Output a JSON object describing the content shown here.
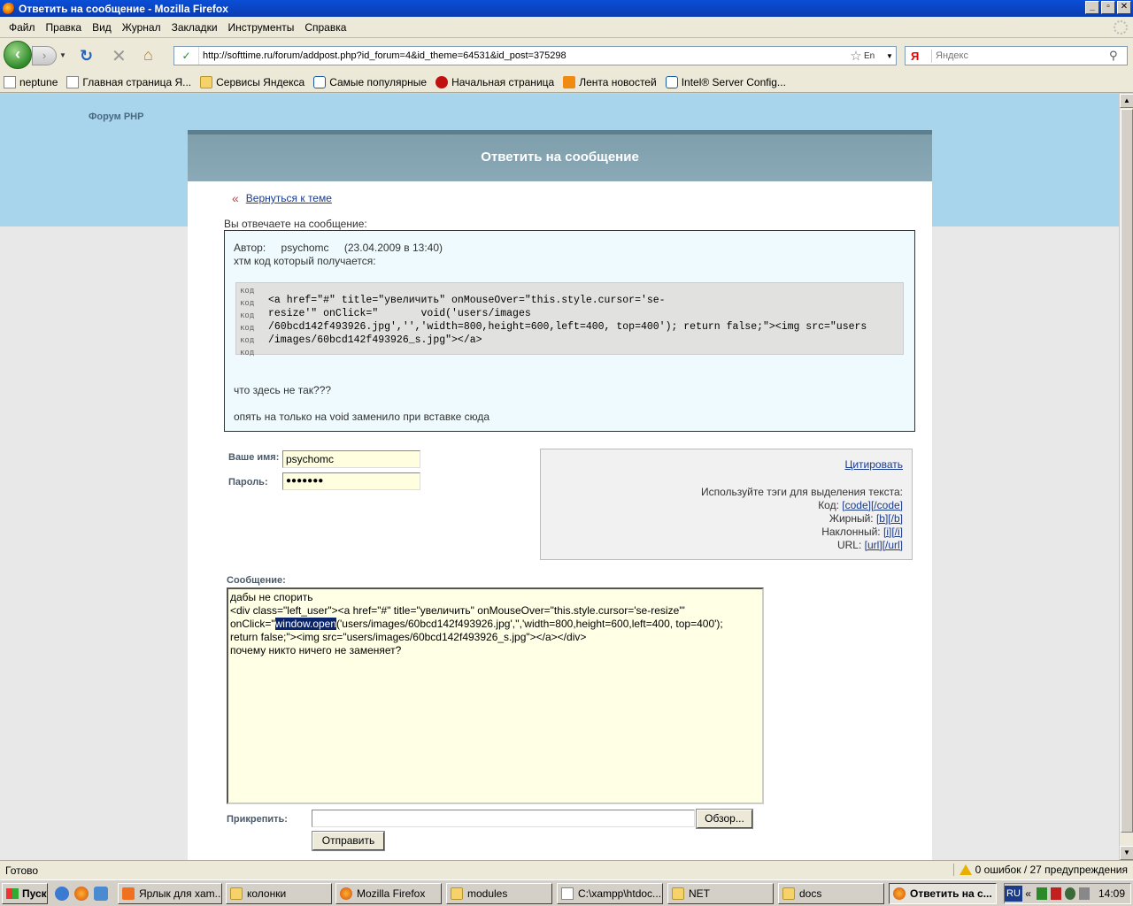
{
  "window": {
    "title": "Ответить на сообщение - Mozilla Firefox",
    "btn_min": "_",
    "btn_max": "▫",
    "btn_close": "✕"
  },
  "menu": [
    "Файл",
    "Правка",
    "Вид",
    "Журнал",
    "Закладки",
    "Инструменты",
    "Справка"
  ],
  "nav": {
    "url": "http://softtime.ru/forum/addpost.php?id_forum=4&id_theme=64531&id_post=375298",
    "lang_indicator": "En",
    "search_placeholder": "Яндекс",
    "search_engine": "Я"
  },
  "bookmarks": [
    {
      "label": "neptune",
      "icon": "page-icon"
    },
    {
      "label": "Главная страница Я...",
      "icon": "page-icon"
    },
    {
      "label": "Сервисы Яндекса",
      "icon": "folder-icon"
    },
    {
      "label": "Самые популярные",
      "icon": "bookmark-icon"
    },
    {
      "label": "Начальная страница",
      "icon": "red-icon"
    },
    {
      "label": "Лента новостей",
      "icon": "rss-icon"
    },
    {
      "label": "Intel® Server Config...",
      "icon": "intel-icon"
    }
  ],
  "page": {
    "forum_link": "Форум PHP",
    "header": "Ответить на сообщение",
    "back_link": "Вернуться к теме",
    "back_arrow": "«",
    "reply_to": "Вы отвечаете на сообщение:",
    "quote": {
      "author_label": "Автор:",
      "author": "psychomc",
      "date": "(23.04.2009 в 13:40)",
      "line1": "хтм код который получается:",
      "gutter": [
        "код",
        "код",
        "код",
        "код",
        "код",
        "код"
      ],
      "code": "<a href=\"#\" title=\"увеличить\" onMouseOver=\"this.style.cursor='se-\nresize'\" onClick=\"       void('users/images\n/60bcd142f493926.jpg','','width=800,height=600,left=400, top=400'); return false;\"><img src=\"users\n/images/60bcd142f493926_s.jpg\"></a>",
      "q1": "что здесь не так???",
      "q2": "опять на только на void заменило при вставке сюда"
    },
    "form": {
      "name_label": "Ваше имя:",
      "name_value": "psychomc",
      "password_label": "Пароль:",
      "password_value": "●●●●●●●",
      "message_label": "Сообщение:",
      "attach_label": "Прикрепить:",
      "browse_button": "Обзор...",
      "submit_button": "Отправить",
      "message_lines": {
        "l1": "дабы не спорить",
        "l2": "<div class=\"left_user\"><a href=\"#\" title=\"увеличить\" onMouseOver=\"this.style.cursor='se-resize'\"",
        "l3_pre": "onClick=\"",
        "l3_sel": "window.open",
        "l3_post": "('users/images/60bcd142f493926.jpg','','width=800,height=600,left=400, top=400');",
        "l4": "return false;\"><img src=\"users/images/60bcd142f493926_s.jpg\"></a></div>",
        "l5": "почему никто ничего не заменяет?"
      }
    },
    "tags": {
      "cite": "Цитировать",
      "hint": "Используйте тэги для выделения текста:",
      "code_label": "Код:",
      "code_tag": "[code][/code]",
      "bold_label": "Жирный:",
      "bold_tag": "[b][/b]",
      "italic_label": "Наклонный:",
      "italic_tag": "[i][/i]",
      "url_label": "URL:",
      "url_tag": "[url][/url]"
    }
  },
  "status": {
    "text": "Готово",
    "errors": "0 ошибок / 27 предупреждения"
  },
  "taskbar": {
    "start": "Пуск",
    "tasks": [
      {
        "label": "Ярлык для xam...",
        "icon": "shortcut-icon"
      },
      {
        "label": "колонки",
        "icon": "folder-icon"
      },
      {
        "label": "Mozilla Firefox",
        "icon": "firefox-icon"
      },
      {
        "label": "modules",
        "icon": "folder-icon"
      },
      {
        "label": "C:\\xampp\\htdoc...",
        "icon": "document-icon"
      },
      {
        "label": "NET",
        "icon": "folder-icon"
      },
      {
        "label": "docs",
        "icon": "folder-icon"
      },
      {
        "label": "Ответить на с...",
        "icon": "firefox-icon"
      }
    ],
    "lang": "RU",
    "tray_arrow": "«",
    "clock": "14:09"
  }
}
